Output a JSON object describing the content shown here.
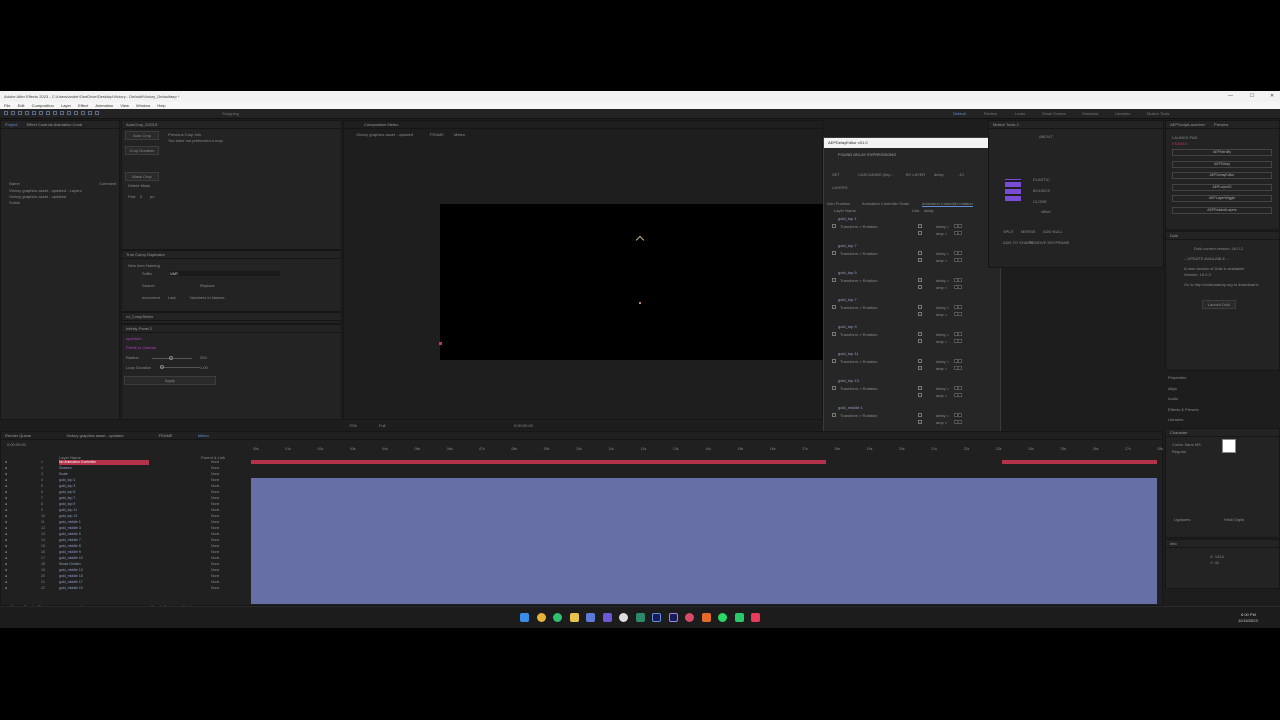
{
  "window": {
    "title": "Adobe After Effects 2023 - C:\\Users\\ander\\OneDrive\\Desktop\\Victory - Default\\Victory_Defaultaep *",
    "controls": [
      "—",
      "☐",
      "✕"
    ]
  },
  "menu": [
    "File",
    "Edit",
    "Composition",
    "Layer",
    "Effect",
    "Animation",
    "View",
    "Window",
    "Help"
  ],
  "toolbar": {
    "snapping": "Snapping",
    "workspaces": [
      "Default",
      "Review",
      "Learn",
      "Small Screen",
      "Standard",
      "Libraries",
      "Motion Tools"
    ],
    "active_workspace": "Default"
  },
  "project": {
    "tabs": [
      "Project",
      "Effect Controls Animation Contr"
    ],
    "header_name": "Name",
    "header_comment": "Comment",
    "items": [
      "Victory graphics asset - updated - Layers",
      "Victory graphics asset - updated",
      "Solids"
    ]
  },
  "autocrop": {
    "tab": "AutoCrop_2023.5",
    "buttons": [
      "Auto Crop",
      "Crop Duration",
      "Mask Crop"
    ],
    "delete_mask": "Delete Mask",
    "pad_label": "Pad:",
    "pad_value": "0",
    "unit": "px",
    "previous_label": "Previous Crop Info",
    "previous_value": "You have not preformed a crop."
  },
  "truecomp": {
    "tab": "True Comp Duplicator",
    "naming": "New Item Naming",
    "suffix": "Suffix",
    "suffix_value": "VAR",
    "search": "Search",
    "replace": "Replace",
    "increment": "Increment",
    "increment_mode": "Last",
    "numbers_in_names": "Numbers In Names"
  },
  "rd": {
    "tab": "rd_CompSetter"
  },
  "infinity": {
    "tab": "Infinity Panel 2",
    "link1": "openInfo",
    "link2": "Pixels to Cinema",
    "radius_label": "Radius",
    "radius_value": "200",
    "loop_label": "Loop Duration",
    "loop_value": "1.00",
    "apply": "Apply"
  },
  "composition": {
    "tab": "Composition Meteo",
    "breadcrumbs": [
      "Victory graphics asset - updated",
      "FRAME",
      "Meteo"
    ],
    "zoom": "70%",
    "quality": "Full",
    "timecode": "0:00:00:00"
  },
  "dialog": {
    "title": "AEPDelayEditor v01.0",
    "found": "FOUND DELAY EXPRESSIONS",
    "mode": "CASCADING (linp...",
    "order": "BY LAYER",
    "delay_label": "delay",
    "delay_value": "-10",
    "set_label": "SET",
    "layers_label": "LAYERS",
    "tabs": [
      "Gen Position",
      "Animation Controller Scale",
      "Animation Controller rotation"
    ],
    "active_tab": "Animation Controller rotation",
    "header": [
      "Layer Name",
      "Link",
      "delay"
    ],
    "rows": [
      {
        "name": "gold_top 1",
        "prop": "Transform > Rotation",
        "d1": "delay =",
        "v1": "0",
        "d2": "amp =",
        "v2": "1"
      },
      {
        "name": "gold_top 7",
        "prop": "Transform > Rotation",
        "d1": "delay =",
        "v1": "0",
        "d2": "amp =",
        "v2": "1"
      },
      {
        "name": "gold_top 5",
        "prop": "Transform > Rotation",
        "d1": "delay =",
        "v1": "0",
        "d2": "amp =",
        "v2": "1"
      },
      {
        "name": "gold_top 7",
        "prop": "Transform > Rotation",
        "d1": "delay =",
        "v1": "0",
        "d2": "amp =",
        "v2": "1"
      },
      {
        "name": "gold_top 9",
        "prop": "Transform > Rotation",
        "d1": "delay =",
        "v1": "0",
        "d2": "amp =",
        "v2": "1"
      },
      {
        "name": "gold_top 11",
        "prop": "Transform > Rotation",
        "d1": "delay =",
        "v1": "0",
        "d2": "amp =",
        "v2": "1"
      },
      {
        "name": "gold_top 13",
        "prop": "Transform > Rotation",
        "d1": "delay =",
        "v1": "0",
        "d2": "amp =",
        "v2": "1"
      },
      {
        "name": "gold_middle 1",
        "prop": "Transform > Rotation",
        "d1": "delay =",
        "v1": "0",
        "d2": "amp =",
        "v2": "1"
      },
      {
        "name": "gold_middle 3",
        "prop": "Transform > Rotation",
        "d1": "delay =",
        "v1": "0",
        "d2": "amp =",
        "v2": "1"
      },
      {
        "name": "gold_middle 5",
        "prop": "Transform > Rotation",
        "d1": "delay =",
        "v1": "0",
        "d2": "amp =",
        "v2": "1"
      },
      {
        "name": "gold_middle 10",
        "prop": "Transform > Rotation",
        "d1": "delay =",
        "v1": "0",
        "d2": "amp =",
        "v2": "1"
      },
      {
        "name": "gold_middle 13",
        "prop": "Transform > Rotation",
        "d1": "delay =",
        "v1": "0",
        "d2": "amp =",
        "v2": "1"
      },
      {
        "name": "gold_middle 15",
        "prop": "Transform > Rotation",
        "d1": "delay =",
        "v1": "0",
        "d2": "amp =",
        "v2": "1"
      },
      {
        "name": "gold_middle 17",
        "prop": "Transform > Rotation",
        "d1": "delay =",
        "v1": "0",
        "d2": "amp =",
        "v2": "1"
      }
    ]
  },
  "motion": {
    "tab": "Motion Tools 2",
    "about": "ABOUT",
    "labels": [
      "ELASTIC",
      "BOUNCE",
      "CLONE",
      "offset",
      "text"
    ],
    "actions": [
      "SPLIT",
      "MERGE",
      "ADD NULL",
      "ADD TO SHAPE",
      "REMOVE KEYFRAME"
    ]
  },
  "launcher": {
    "tab": "AEPScriptLauncher",
    "tab2": "Preview",
    "title": "LAUNCH PAD",
    "subtitle": "ENABLE",
    "scripts": [
      "AEPNerdify",
      "AEPDelay",
      "AEPDelayEditor",
      "AEPLayerID",
      "AEPLayerWiggle",
      "AEPRelabelLayers"
    ]
  },
  "duik": {
    "tab": "Duik",
    "version": "Duik current version: 16.0.2",
    "update": "– UPDATE AVAILABLE –",
    "new_version": "A new version of Duik is available!",
    "new_number": "Version: 16.0.3",
    "goto": "Go to http://rxlaboratory.org to download it.",
    "launch": "Launch Duik"
  },
  "side_panels": [
    "Properties",
    "Align",
    "Audio",
    "Effects & Presets",
    "Libraries",
    "Character"
  ],
  "character": {
    "font": "Comic Sans MS",
    "style": "Regular",
    "ligatures": "Ligatures",
    "hindi": "Hindi Digits"
  },
  "info": {
    "tab": "Info",
    "x": "X: 1424",
    "y": "Y: 42"
  },
  "timeline": {
    "tabs": [
      "Render Queue",
      "Victory graphics asset - updated",
      "FRAME",
      "Meteo"
    ],
    "timecode": "0:00:00:00",
    "col_name": "Layer Name",
    "col_parent": "Parent & Link",
    "toggle": "Toggle Switches / Modes",
    "render_time": "Frame Render Time",
    "render_value": "0ms",
    "layers": [
      "No Animation Controller",
      "Shadow",
      "Scale",
      "gold_top 1",
      "gold_top 3",
      "gold_top 5",
      "gold_top 7",
      "gold_top 9",
      "gold_top 11",
      "gold_top 13",
      "gold_middle 1",
      "gold_middle 3",
      "gold_middle 5",
      "gold_middle 7",
      "gold_middle 8",
      "gold_middle 9",
      "gold_middle 10",
      "Smart Golden",
      "gold_middle 13",
      "gold_middle 15",
      "gold_middle 17",
      "gold_middle 19"
    ],
    "parent_value": "None",
    "ticks": [
      "00s",
      "01s",
      "02s",
      "03s",
      "04s",
      "05s",
      "06s",
      "07s",
      "08s",
      "09s",
      "10s",
      "11s",
      "12s",
      "13s",
      "14s",
      "15s",
      "16s",
      "17s",
      "18s",
      "19s",
      "20s",
      "21s",
      "22s",
      "23s",
      "24s",
      "25s",
      "26s",
      "27s",
      "28s"
    ]
  },
  "taskbar": {
    "time": "6:00 PM",
    "date": "11/15/2023"
  },
  "colors": {
    "accent": "#5b8fd8",
    "layer_bar": "#6872a8",
    "red": "#b5334a",
    "purple": "#7a4bd6"
  }
}
